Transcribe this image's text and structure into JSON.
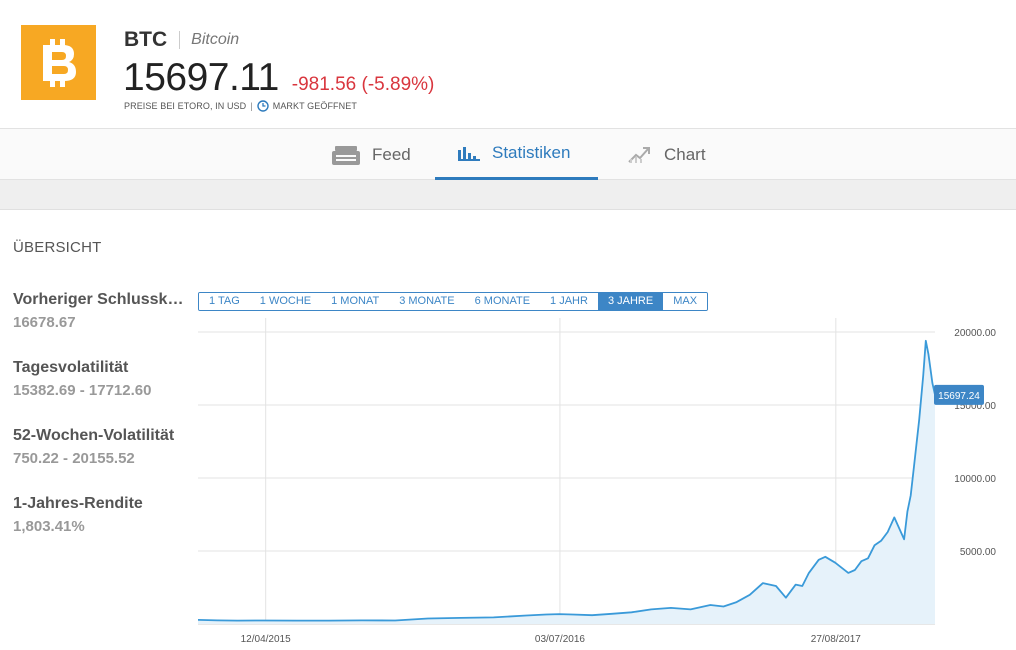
{
  "asset": {
    "ticker": "BTC",
    "name": "Bitcoin",
    "price": "15697.11",
    "change": "-981.56 (-5.89%)",
    "price_info": "PREISE BEI ETORO, IN USD",
    "market_status": "MARKT GEÖFFNET",
    "logo_icon": "bitcoin-logo-icon",
    "logo_color": "#f7a823"
  },
  "tabs": [
    {
      "label": "Feed",
      "icon": "feed-icon",
      "active": false
    },
    {
      "label": "Statistiken",
      "icon": "bar-chart-icon",
      "active": true
    },
    {
      "label": "Chart",
      "icon": "trend-chart-icon",
      "active": false
    }
  ],
  "overview": {
    "title": "ÜBERSICHT",
    "stats": [
      {
        "label": "Vorheriger Schlusskurs",
        "value": "16678.67"
      },
      {
        "label": "Tagesvolatilität",
        "value": "15382.69 - 17712.60"
      },
      {
        "label": "52-Wochen-Volatilität",
        "value": "750.22 - 20155.52"
      },
      {
        "label": "1-Jahres-Rendite",
        "value": "1,803.41%"
      }
    ]
  },
  "ranges": [
    "1 TAG",
    "1 WOCHE",
    "1 MONAT",
    "3 MONATE",
    "6 MONATE",
    "1 JAHR",
    "3 JAHRE",
    "MAX"
  ],
  "active_range": "3 JAHRE",
  "colors": {
    "accent": "#3d86c6",
    "negative": "#d9363e",
    "line": "#3a9ad9",
    "area": "#e6f2fa"
  },
  "chart_data": {
    "type": "area",
    "y_ticks": [
      "5000.00",
      "10000.00",
      "15000.00",
      "20000.00"
    ],
    "x_ticks": [
      {
        "label": "12/04/2015",
        "t": 103
      },
      {
        "label": "03/07/2016",
        "t": 551
      },
      {
        "label": "27/08/2017",
        "t": 971
      }
    ],
    "ylim": [
      0,
      20000
    ],
    "xlim": [
      0,
      1122
    ],
    "last_value_label": "15697.24",
    "grid": true,
    "x": [
      0,
      30,
      60,
      100,
      150,
      200,
      250,
      300,
      350,
      400,
      450,
      500,
      530,
      550,
      570,
      600,
      630,
      660,
      690,
      720,
      750,
      780,
      800,
      820,
      840,
      860,
      880,
      895,
      910,
      920,
      930,
      945,
      955,
      970,
      990,
      1000,
      1010,
      1020,
      1030,
      1040,
      1050,
      1060,
      1065,
      1075,
      1080,
      1085,
      1090,
      1098,
      1104,
      1108,
      1112,
      1118,
      1122
    ],
    "y": [
      280,
      250,
      230,
      240,
      230,
      235,
      250,
      240,
      380,
      420,
      450,
      580,
      650,
      680,
      650,
      600,
      700,
      800,
      1000,
      1100,
      1000,
      1300,
      1200,
      1500,
      2000,
      2800,
      2600,
      1800,
      2700,
      2600,
      3500,
      4400,
      4600,
      4200,
      3500,
      3700,
      4300,
      4500,
      5400,
      5700,
      6300,
      7300,
      6800,
      5800,
      7700,
      8800,
      10800,
      14000,
      17000,
      19400,
      18500,
      16500,
      15697.24
    ]
  }
}
